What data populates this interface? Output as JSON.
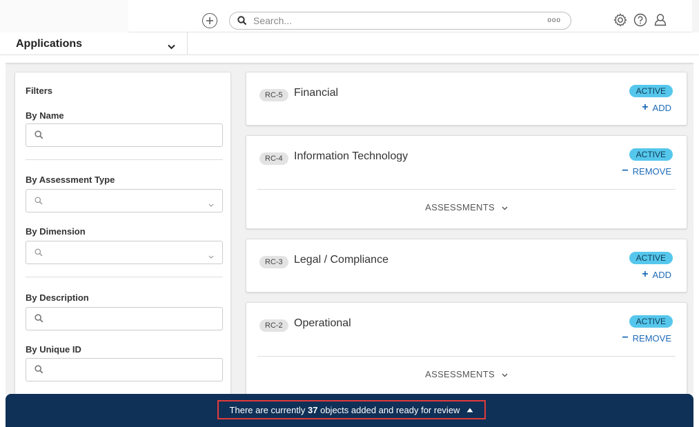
{
  "header": {
    "search_placeholder": "Search...",
    "search_more": "ooo",
    "icons": [
      "plus-circle-icon",
      "search-icon",
      "gear-icon",
      "help-icon",
      "user-icon"
    ]
  },
  "app_selector": {
    "label": "Applications"
  },
  "filters": {
    "title": "Filters",
    "by_name": "By Name",
    "by_assessment_type": "By Assessment Type",
    "by_dimension": "By Dimension",
    "by_description": "By Description",
    "by_unique_id": "By Unique ID"
  },
  "cards": [
    {
      "code": "RC-5",
      "title": "Financial",
      "status": "ACTIVE",
      "action_symbol": "+",
      "action": "ADD"
    },
    {
      "code": "RC-4",
      "title": "Information Technology",
      "status": "ACTIVE",
      "action_symbol": "−",
      "action": "REMOVE",
      "assessments": "ASSESSMENTS"
    },
    {
      "code": "RC-3",
      "title": "Legal / Compliance",
      "status": "ACTIVE",
      "action_symbol": "+",
      "action": "ADD"
    },
    {
      "code": "RC-2",
      "title": "Operational",
      "status": "ACTIVE",
      "action_symbol": "−",
      "action": "REMOVE",
      "assessments": "ASSESSMENTS"
    }
  ],
  "banner": {
    "prefix": "There are currently",
    "count": "37",
    "suffix": "objects added and ready for review"
  },
  "colors": {
    "banner_bg": "#0f3057",
    "highlight_border": "#e23b3b",
    "status_badge": "#56c7ec",
    "action_link": "#1e6bb8"
  }
}
